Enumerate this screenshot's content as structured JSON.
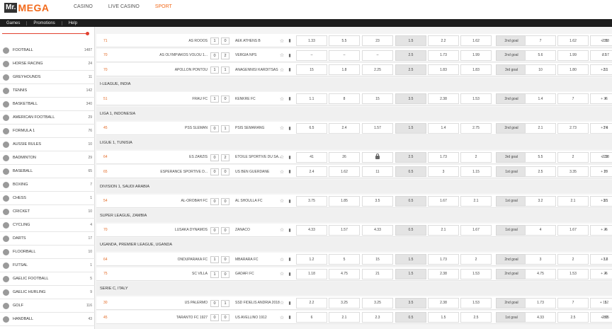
{
  "brand": {
    "mr": "Mr.",
    "mega": "MEGA"
  },
  "nav": {
    "items": [
      "CASINO",
      "LIVE CASINO",
      "SPORT"
    ],
    "active": 2
  },
  "subnav": [
    "Games",
    "Promotions",
    "Help"
  ],
  "colors": {
    "accent": "#f26a1b",
    "slider": "#e2412f"
  },
  "sports": [
    {
      "label": "FOOTBALL",
      "count": "1487",
      "icon": "football-icon"
    },
    {
      "label": "HORSE RACING",
      "count": "24",
      "icon": "horse-icon"
    },
    {
      "label": "GREYHOUNDS",
      "count": "11",
      "icon": "greyhound-icon"
    },
    {
      "label": "TENNIS",
      "count": "142",
      "icon": "tennis-icon"
    },
    {
      "label": "BASKETBALL",
      "count": "340",
      "icon": "basketball-icon"
    },
    {
      "label": "AMERICAN FOOTBALL",
      "count": "29",
      "icon": "american-football-icon"
    },
    {
      "label": "FORMULA 1",
      "count": "76",
      "icon": "flag-icon"
    },
    {
      "label": "AUSSIE RULES",
      "count": "10",
      "icon": "aussie-rules-icon"
    },
    {
      "label": "BADMINTON",
      "count": "29",
      "icon": "shuttlecock-icon"
    },
    {
      "label": "BASEBALL",
      "count": "65",
      "icon": "baseball-icon"
    },
    {
      "label": "BOXING",
      "count": "7",
      "icon": "boxing-glove-icon"
    },
    {
      "label": "CHESS",
      "count": "1",
      "icon": "chess-icon"
    },
    {
      "label": "CRICKET",
      "count": "10",
      "icon": "cricket-icon"
    },
    {
      "label": "CYCLING",
      "count": "4",
      "icon": "bicycle-icon"
    },
    {
      "label": "DARTS",
      "count": "17",
      "icon": "dartboard-icon"
    },
    {
      "label": "FLOORBALL",
      "count": "10",
      "icon": "floorball-icon"
    },
    {
      "label": "FUTSAL",
      "count": "1",
      "icon": "futsal-icon"
    },
    {
      "label": "GAELIC FOOTBALL",
      "count": "5",
      "icon": "gaelic-football-icon"
    },
    {
      "label": "GAELIC HURLING",
      "count": "9",
      "icon": "hurling-icon"
    },
    {
      "label": "GOLF",
      "count": "116",
      "icon": "golf-icon"
    },
    {
      "label": "HANDBALL",
      "count": "43",
      "icon": "handball-icon"
    }
  ],
  "rows": [
    {
      "kind": "match",
      "min": "71",
      "home": "AS ROOOS",
      "sh": "1",
      "sa": "0",
      "away": "AEK ATHENS B",
      "odds": [
        "1.33",
        "5.5",
        "23",
        "1.5",
        "2.2",
        "1.62",
        "2nd goal",
        "7",
        "1.62",
        "2.88"
      ],
      "more": "+ 31"
    },
    {
      "kind": "match",
      "min": "70",
      "home": "AS OLYMPIAKOS VOLOU 1...",
      "sh": "0",
      "sa": "2",
      "away": "VERGIA NPS",
      "odds": [
        "–",
        "–",
        "–",
        "2.5",
        "1.73",
        "1.99",
        "2nd goal",
        "5.6",
        "1.99",
        "2.17"
      ],
      "more": "+ 9"
    },
    {
      "kind": "match",
      "min": "70",
      "home": "APOLLON PONTOU",
      "sh": "1",
      "sa": "1",
      "away": "ANAGENNISI KARDITSAS",
      "odds": [
        "15",
        "1.8",
        "2.25",
        "2.5",
        "1.83",
        "1.83",
        "3rd goal",
        "10",
        "1.80",
        "2.1"
      ],
      "more": "+ 31"
    },
    {
      "kind": "league",
      "label": "I-LEAGUE, INDIA"
    },
    {
      "kind": "match",
      "min": "51",
      "home": "FRAU FC",
      "sh": "1",
      "sa": "0",
      "away": "KENKRE FC",
      "odds": [
        "1.1",
        "8",
        "15",
        "3.5",
        "2.38",
        "1.53",
        "2nd goal",
        "1.4",
        "7",
        "4"
      ],
      "more": "+ 36"
    },
    {
      "kind": "league",
      "label": "LIGA 1, INDONESIA"
    },
    {
      "kind": "match",
      "min": "45",
      "home": "PSS SLEMAN",
      "sh": "0",
      "sa": "1",
      "away": "PSIS SEMARANG",
      "odds": [
        "6.5",
        "2.4",
        "1.57",
        "1.5",
        "1.4",
        "2.75",
        "2nd goal",
        "2.1",
        "2.73",
        "3.6"
      ],
      "more": "+ 74"
    },
    {
      "kind": "league",
      "label": "LIGUE 1, TUNISIA"
    },
    {
      "kind": "match",
      "min": "64",
      "home": "ES ZARZIS",
      "sh": "0",
      "sa": "2",
      "away": "ETOILE SPORTIVE DU SA...",
      "odds": [
        "41",
        "26",
        "lock",
        "2.5",
        "1.73",
        "2",
        "3rd goal",
        "5.5",
        "2",
        "2.38"
      ],
      "more": "+ 29"
    },
    {
      "kind": "match",
      "min": "65",
      "home": "ESPERANCE SPORTIVE D...",
      "sh": "0",
      "sa": "0",
      "away": "US BEN GUERDANE",
      "odds": [
        "2.4",
        "1.62",
        "11",
        "0.5",
        "3",
        "1.15",
        "1st goal",
        "2.5",
        "3.35",
        "10"
      ],
      "more": "+ 25"
    },
    {
      "kind": "league",
      "label": "DIVISION 1, SAUDI ARABIA"
    },
    {
      "kind": "match",
      "min": "54",
      "home": "AL-OROBAH FC",
      "sh": "0",
      "sa": "0",
      "away": "AL SHOULLA FC",
      "odds": [
        "3.75",
        "1.85",
        "3.5",
        "0.5",
        "1.67",
        "2.1",
        "1st goal",
        "3.2",
        "2.1",
        "3.1"
      ],
      "more": "+ 35"
    },
    {
      "kind": "league",
      "label": "SUPER LEAGUE, ZAMBIA"
    },
    {
      "kind": "match",
      "min": "70",
      "home": "LUSAKA DYNAMOS",
      "sh": "0",
      "sa": "0",
      "away": "ZANACO",
      "odds": [
        "4.33",
        "1.57",
        "4.33",
        "0.5",
        "2.1",
        "1.67",
        "1st goal",
        "4",
        "1.67",
        "4"
      ],
      "more": "+ 25"
    },
    {
      "kind": "league",
      "label": "UGANDA, PREMIER LEAGUE, UGANDA"
    },
    {
      "kind": "match",
      "min": "64",
      "home": "ONDUPARAKA FC",
      "sh": "1",
      "sa": "0",
      "away": "MBARARA FC",
      "odds": [
        "1.2",
        "5",
        "15",
        "1.5",
        "1.73",
        "2",
        "2nd goal",
        "3",
        "2",
        "3.6"
      ],
      "more": "+ 12"
    },
    {
      "kind": "match",
      "min": "75",
      "home": "SC VILLA",
      "sh": "1",
      "sa": "0",
      "away": "GADAFI FC",
      "odds": [
        "1.18",
        "4.75",
        "21",
        "1.5",
        "2.38",
        "1.53",
        "2nd goal",
        "4.75",
        "1.53",
        "4"
      ],
      "more": "+ 25"
    },
    {
      "kind": "league",
      "label": "SERIE C, ITALY"
    },
    {
      "kind": "match",
      "min": "30",
      "home": "US PALERMO",
      "sh": "0",
      "sa": "1",
      "away": "SSD FIDELIS ANDRIA 2018",
      "odds": [
        "2.2",
        "3.25",
        "3.25",
        "3.5",
        "2.38",
        "1.53",
        "2nd goal",
        "1.73",
        "7",
        "5"
      ],
      "more": "+ 112"
    },
    {
      "kind": "match",
      "min": "45",
      "home": "TARANTO FC 1927",
      "sh": "0",
      "sa": "0",
      "away": "US AVELLINO 1912",
      "odds": [
        "6",
        "2.1",
        "2.3",
        "0.5",
        "1.5",
        "2.5",
        "1st goal",
        "4.33",
        "2.5",
        "2.05"
      ],
      "more": "+ 80"
    }
  ]
}
